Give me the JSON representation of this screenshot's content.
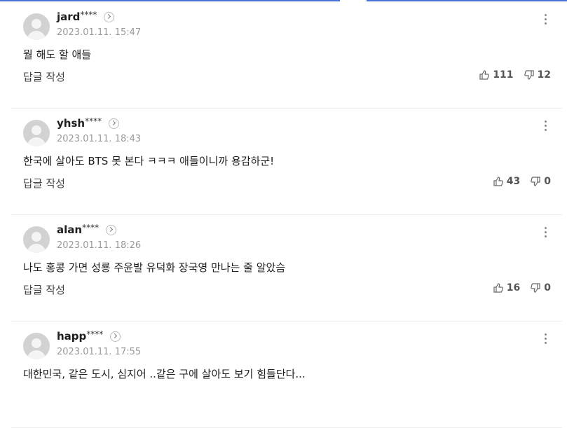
{
  "ui": {
    "reply_label": "답글 작성"
  },
  "comments": [
    {
      "user": "jard",
      "mask": "****",
      "date": "2023.01.11. 15:47",
      "text": "뭘 해도 할 애들",
      "likes": "111",
      "dislikes": "12"
    },
    {
      "user": "yhsh",
      "mask": "****",
      "date": "2023.01.11. 18:43",
      "text": "한국에 살아도 BTS 못 본다 ㅋㅋㅋ 애들이니까 용감하군!",
      "likes": "43",
      "dislikes": "0"
    },
    {
      "user": "alan",
      "mask": "****",
      "date": "2023.01.11. 18:26",
      "text": "나도 홍콩 가면 성룡 주윤발 유덕화 장국영 만나는 줄 알았슴",
      "likes": "16",
      "dislikes": "0"
    },
    {
      "user": "happ",
      "mask": "****",
      "date": "2023.01.11. 17:55",
      "text": "대한민국, 같은 도시, 심지어 ..같은 구에 살아도 보기 힘들단다...",
      "likes": "",
      "dislikes": ""
    }
  ],
  "colors": {
    "accent_bar": "#4a6fd6",
    "date": "#9a9a9a",
    "avatar": "#d2d2d2"
  },
  "icons": {
    "like": "thumbs-up-icon",
    "dislike": "thumbs-down-icon",
    "more": "kebab-menu-icon",
    "profile": "chevron-right-icon"
  }
}
